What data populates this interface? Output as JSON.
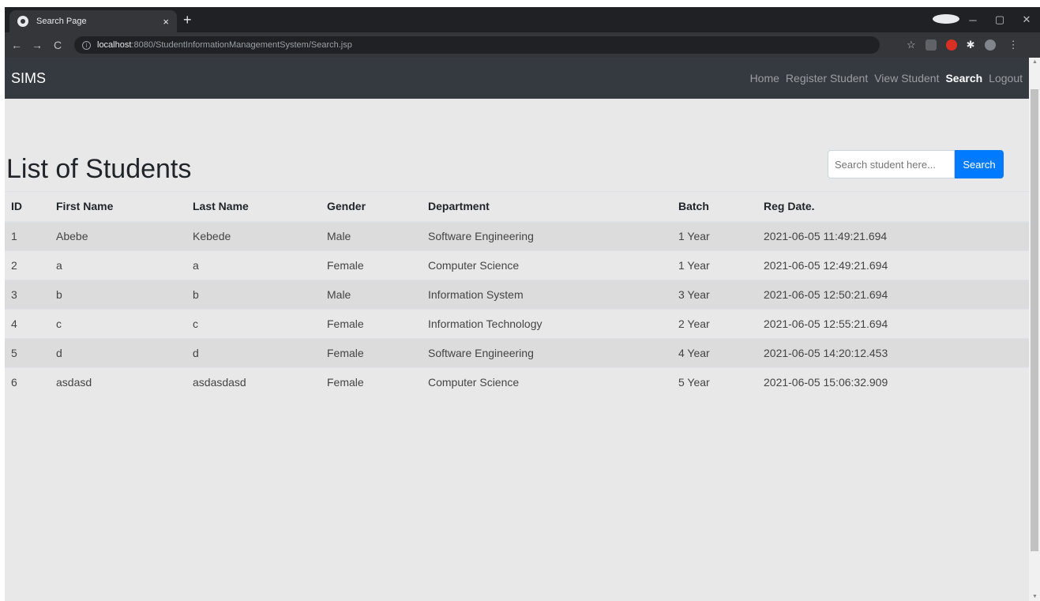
{
  "browser": {
    "tab_title": "Search Page",
    "tab_close": "×",
    "new_tab": "+",
    "url_host": "localhost",
    "url_rest": ":8080/StudentInformationManagementSystem/Search.jsp",
    "back": "←",
    "forward": "→",
    "reload": "C"
  },
  "navbar": {
    "brand": "SIMS",
    "links": [
      "Home",
      "Register Student",
      "View Student",
      "Search",
      "Logout"
    ],
    "active": "Search"
  },
  "main": {
    "heading": "List of Students",
    "search_placeholder": "Search student here...",
    "search_button": "Search"
  },
  "table": {
    "headers": [
      "ID",
      "First Name",
      "Last Name",
      "Gender",
      "Department",
      "Batch",
      "Reg Date."
    ],
    "rows": [
      [
        "1",
        "Abebe",
        "Kebede",
        "Male",
        "Software Engineering",
        "1 Year",
        "2021-06-05 11:49:21.694"
      ],
      [
        "2",
        "a",
        "a",
        "Female",
        "Computer Science",
        "1 Year",
        "2021-06-05 12:49:21.694"
      ],
      [
        "3",
        "b",
        "b",
        "Male",
        "Information System",
        "3 Year",
        "2021-06-05 12:50:21.694"
      ],
      [
        "4",
        "c",
        "c",
        "Female",
        "Information Technology",
        "2 Year",
        "2021-06-05 12:55:21.694"
      ],
      [
        "5",
        "d",
        "d",
        "Female",
        "Software Engineering",
        "4 Year",
        "2021-06-05 14:20:12.453"
      ],
      [
        "6",
        "asdasd",
        "asdasdasd",
        "Female",
        "Computer Science",
        "5 Year",
        "2021-06-05 15:06:32.909"
      ]
    ]
  },
  "colors": {
    "navbar_bg": "#343a40",
    "primary": "#007bff",
    "page_bg": "#e8e8e8"
  }
}
